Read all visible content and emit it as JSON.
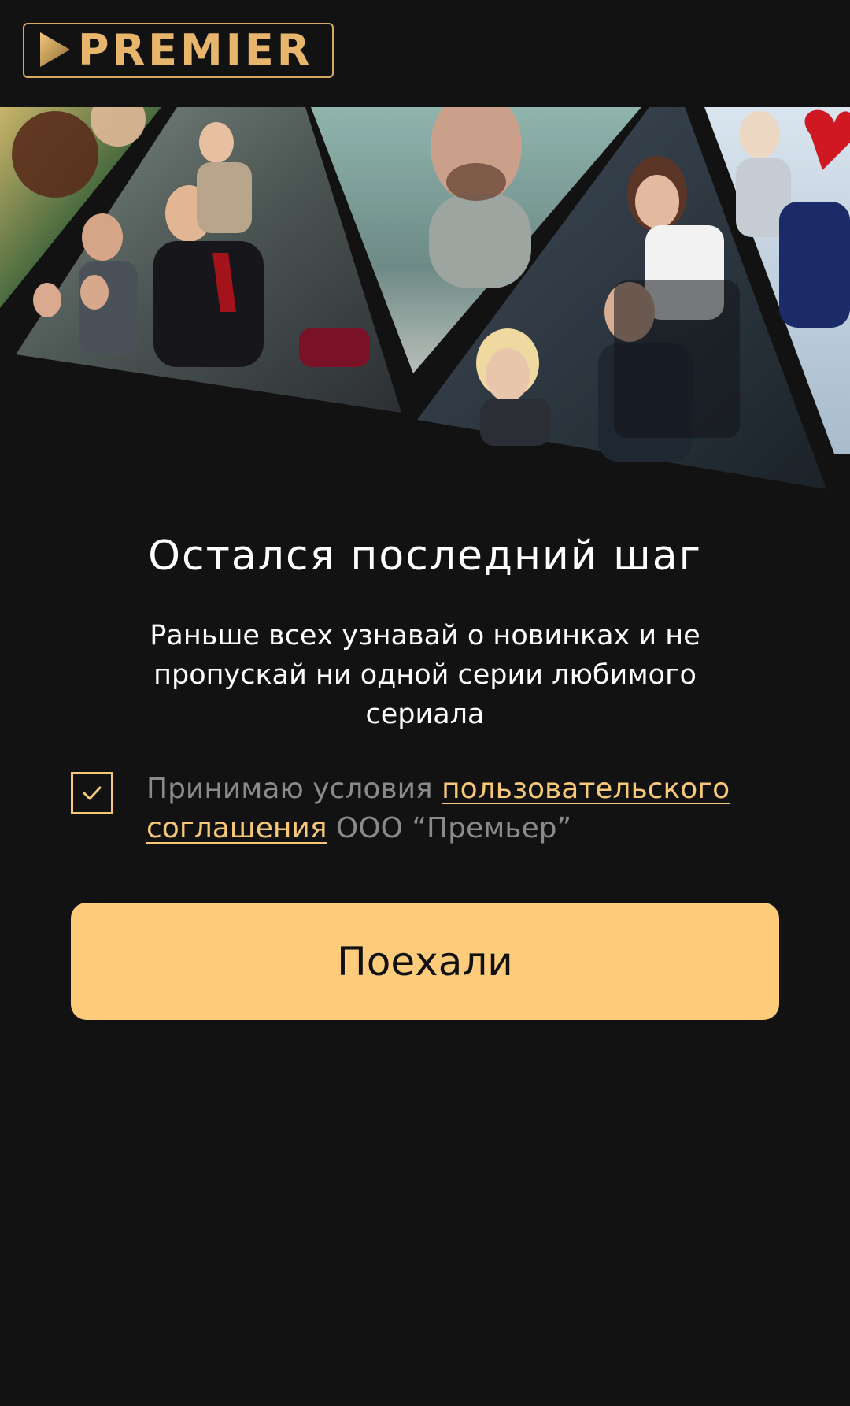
{
  "brand": {
    "name": "PREMIER",
    "gold": "#e7b66c"
  },
  "hero": {
    "panels": [
      "comedy-series-poster",
      "drama-series-poster",
      "thriller-series-poster",
      "office-series-poster",
      "romance-series-poster"
    ]
  },
  "onboarding": {
    "title": "Остался последний шаг",
    "subtitle": "Раньше всех узнавай о новинках и не пропускай ни одной серии любимого сериала"
  },
  "consent": {
    "checked": true,
    "prefix": "Принимаю условия ",
    "link_text": "пользовательского соглашения",
    "suffix": " ООО “Премьер”"
  },
  "cta": {
    "label": "Поехали",
    "color": "#ffcc7c"
  },
  "colors": {
    "background": "#121212",
    "accent": "#f7c878",
    "muted_text": "#8a8a8a"
  }
}
